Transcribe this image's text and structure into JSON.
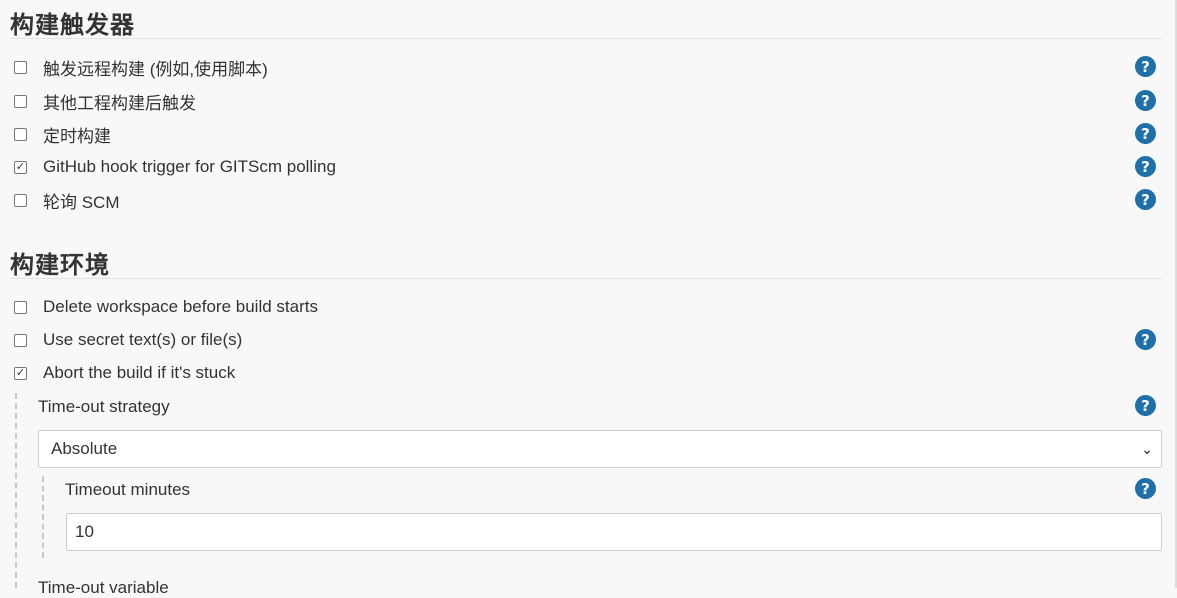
{
  "build_triggers": {
    "title": "构建触发器",
    "items": [
      {
        "label": "触发远程构建 (例如,使用脚本)",
        "checked": false
      },
      {
        "label": "其他工程构建后触发",
        "checked": false
      },
      {
        "label": "定时构建",
        "checked": false
      },
      {
        "label": "GitHub hook trigger for GITScm polling",
        "checked": true
      },
      {
        "label": "轮询 SCM",
        "checked": false
      }
    ]
  },
  "build_env": {
    "title": "构建环境",
    "items": [
      {
        "label": "Delete workspace before build starts",
        "checked": false
      },
      {
        "label": "Use secret text(s) or file(s)",
        "checked": false
      },
      {
        "label": "Abort the build if it's stuck",
        "checked": true
      }
    ],
    "timeout_strategy": {
      "label": "Time-out strategy",
      "selected": "Absolute"
    },
    "timeout_minutes": {
      "label": "Timeout minutes",
      "value": "10"
    },
    "next_label": "Time-out variable"
  },
  "icons": {
    "help": "?",
    "check": "✓",
    "chevron": "⌄"
  },
  "colors": {
    "help_icon": "#1f6fa9",
    "background": "#f8f8f8"
  }
}
